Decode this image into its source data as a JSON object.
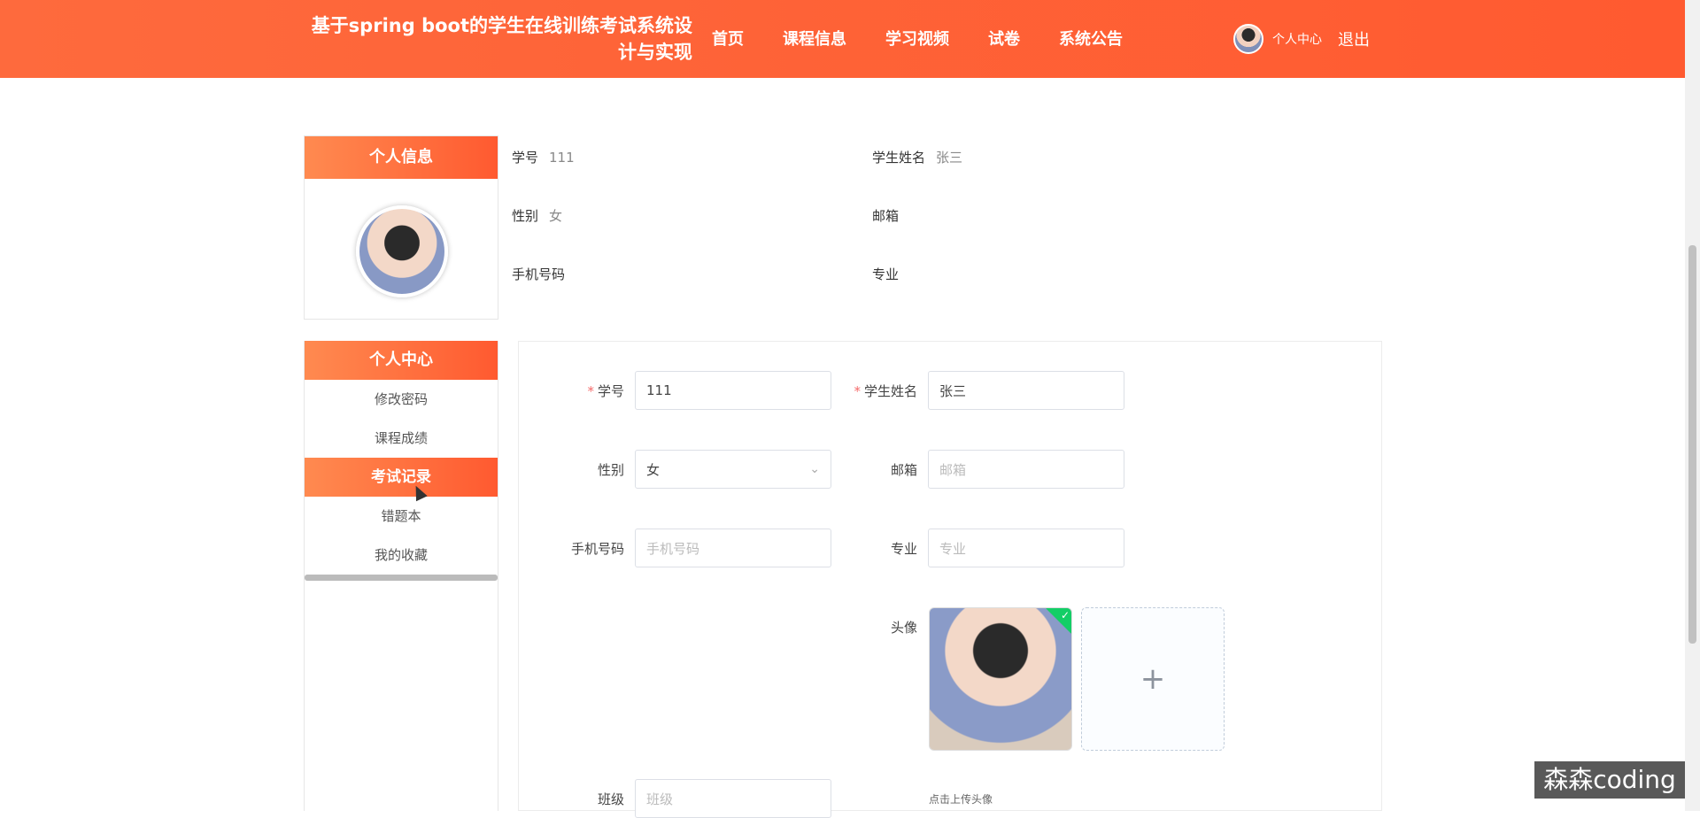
{
  "header": {
    "title": "基于spring boot的学生在线训练考试系统设计与实现",
    "nav": [
      "首页",
      "课程信息",
      "学习视频",
      "试卷",
      "系统公告"
    ],
    "user_center": "个人中心",
    "logout": "退出"
  },
  "profile": {
    "card_title": "个人信息",
    "fields": [
      {
        "label": "学号",
        "value": "111"
      },
      {
        "label": "学生姓名",
        "value": "张三"
      },
      {
        "label": "性别",
        "value": "女"
      },
      {
        "label": "邮箱",
        "value": ""
      },
      {
        "label": "手机号码",
        "value": ""
      },
      {
        "label": "专业",
        "value": ""
      }
    ]
  },
  "menu": {
    "title": "个人中心",
    "items": [
      "修改密码",
      "课程成绩",
      "考试记录",
      "错题本",
      "我的收藏"
    ],
    "active": "考试记录"
  },
  "form": {
    "student_no": {
      "label": "学号",
      "value": "111"
    },
    "student_name": {
      "label": "学生姓名",
      "value": "张三"
    },
    "gender": {
      "label": "性别",
      "value": "女"
    },
    "email": {
      "label": "邮箱",
      "placeholder": "邮箱"
    },
    "phone": {
      "label": "手机号码",
      "placeholder": "手机号码"
    },
    "major": {
      "label": "专业",
      "placeholder": "专业"
    },
    "avatar": {
      "label": "头像",
      "hint": "点击上传头像"
    },
    "class": {
      "label": "班级",
      "placeholder": "班级"
    }
  },
  "watermark": "森森coding",
  "colors": {
    "brand": "#ff5a30",
    "required": "#f56c6c",
    "success": "#13ce66"
  }
}
